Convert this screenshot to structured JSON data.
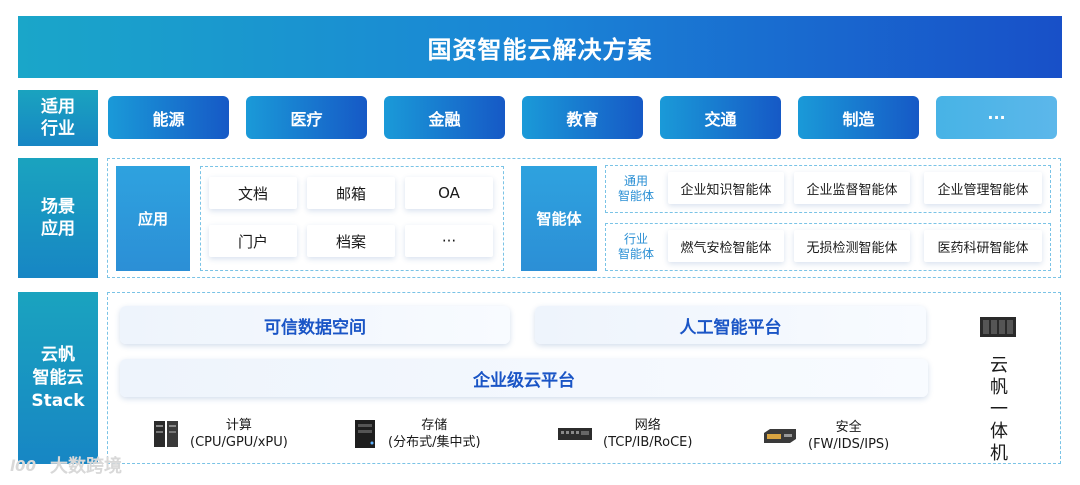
{
  "title": "国资智能云解决方案",
  "industries": {
    "label_line1": "适用",
    "label_line2": "行业",
    "items": [
      "能源",
      "医疗",
      "金融",
      "教育",
      "交通",
      "制造",
      "···"
    ]
  },
  "scenarios": {
    "label_line1": "场景",
    "label_line2": "应用",
    "app_block": "应用",
    "apps": [
      "文档",
      "邮箱",
      "OA",
      "门户",
      "档案",
      "···"
    ],
    "agent_block": "智能体",
    "general": {
      "label_line1": "通用",
      "label_line2": "智能体",
      "items": [
        "企业知识智能体",
        "企业监督智能体",
        "企业管理智能体"
      ]
    },
    "industry": {
      "label_line1": "行业",
      "label_line2": "智能体",
      "items": [
        "燃气安检智能体",
        "无损检测智能体",
        "医药科研智能体"
      ]
    }
  },
  "stack": {
    "label_line1": "云帆",
    "label_line2": "智能云",
    "label_line3": "Stack",
    "trusted_data": "可信数据空间",
    "ai_platform": "人工智能平台",
    "cloud_platform": "企业级云平台",
    "infra": [
      {
        "name": "计算",
        "detail": "(CPU/GPU/xPU)",
        "icon": "server-rack-icon"
      },
      {
        "name": "存储",
        "detail": "(分布式/集中式)",
        "icon": "storage-server-icon"
      },
      {
        "name": "网络",
        "detail": "(TCP/IB/RoCE)",
        "icon": "network-switch-icon"
      },
      {
        "name": "安全",
        "detail": "(FW/IDS/IPS)",
        "icon": "firewall-appliance-icon"
      }
    ],
    "appliance_chars": [
      "云",
      "帆",
      "一",
      "体",
      "机"
    ]
  },
  "watermark": "大数跨境",
  "colors": {
    "primary": "#1659c6",
    "accent": "#1aa6c9",
    "text_blue": "#1a55c6"
  }
}
